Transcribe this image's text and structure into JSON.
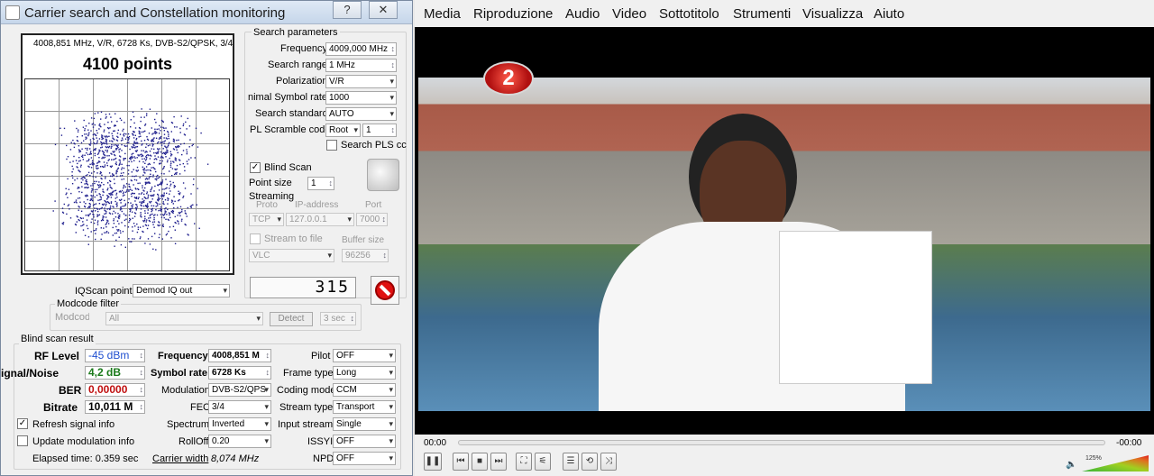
{
  "window": {
    "title": "Carrier search and Constellation monitoring",
    "help_btn": "?",
    "close_btn": "✕"
  },
  "constellation": {
    "info": "4008,851 MHz, V/R, 6728 Ks, DVB-S2/QPSK, 3/4",
    "points": "4100 points"
  },
  "search": {
    "group": "Search parameters",
    "frequency_label": "Frequency",
    "frequency": "4009,000 MHz",
    "range_label": "Search range",
    "range": "1 MHz",
    "polarization_label": "Polarization",
    "polarization": "V/R",
    "min_sr_label": "nimal Symbol rate",
    "min_sr": "1000",
    "standard_label": "Search standard",
    "standard": "AUTO",
    "pls_label": "PL Scramble code",
    "pls_mode": "Root",
    "pls_value": "1",
    "search_pls": "Search PLS cc",
    "blind_scan": "Blind Scan",
    "point_size_label": "Point size",
    "point_size": "1",
    "streaming": "Streaming",
    "proto_label": "Proto",
    "ip_label": "IP-address",
    "port_label": "Port",
    "proto": "TCP",
    "ip": "127.0.0.1",
    "port": "7000",
    "stream_to_file": "Stream to file",
    "buffer_label": "Buffer size",
    "player": "VLC",
    "buffer": "96256"
  },
  "iq": {
    "label": "IQScan point",
    "value": "Demod IQ out",
    "counter": "315"
  },
  "modcode": {
    "group": "Modcode filter",
    "label": "Modcode",
    "value": "All",
    "detect": "Detect",
    "secs": "3 sec"
  },
  "result": {
    "group": "Blind scan result",
    "rf_label": "RF Level",
    "rf": "-45 dBm",
    "snr_label": "ignal/Noise",
    "snr": "4,2 dB",
    "ber_label": "BER",
    "ber": "0,00000",
    "bitrate_label": "Bitrate",
    "bitrate": "10,011 M",
    "freq_label": "Frequency",
    "freq": "4008,851 M",
    "sr_label": "Symbol rate",
    "sr": "6728 Ks",
    "mod_label": "Modulation",
    "mod": "DVB-S2/QPS",
    "fec_label": "FEC",
    "fec": "3/4",
    "spectrum_label": "Spectrum",
    "spectrum": "Inverted",
    "rolloff_label": "RollOff",
    "rolloff": "0.20",
    "cw_label": "Carrier width",
    "cw": "8,074 MHz",
    "pilot_label": "Pilot",
    "pilot": "OFF",
    "frame_label": "Frame type",
    "frame": "Long",
    "coding_label": "Coding mode",
    "coding": "CCM",
    "stype_label": "Stream type",
    "stype": "Transport",
    "istream_label": "Input stream",
    "istream": "Single",
    "issyi_label": "ISSYI",
    "issyi": "OFF",
    "npd_label": "NPD",
    "npd": "OFF",
    "refresh": "Refresh signal info",
    "update_mod": "Update modulation info",
    "elapsed": "Elapsed time: 0.359 sec"
  },
  "vlc": {
    "menu": [
      "Media",
      "Riproduzione",
      "Audio",
      "Video",
      "Sottotitolo",
      "Strumenti",
      "Visualizza",
      "Aiuto"
    ],
    "time_elapsed": "00:00",
    "time_remaining": "-00:00",
    "volume": "125%",
    "channel_logo": "2"
  }
}
